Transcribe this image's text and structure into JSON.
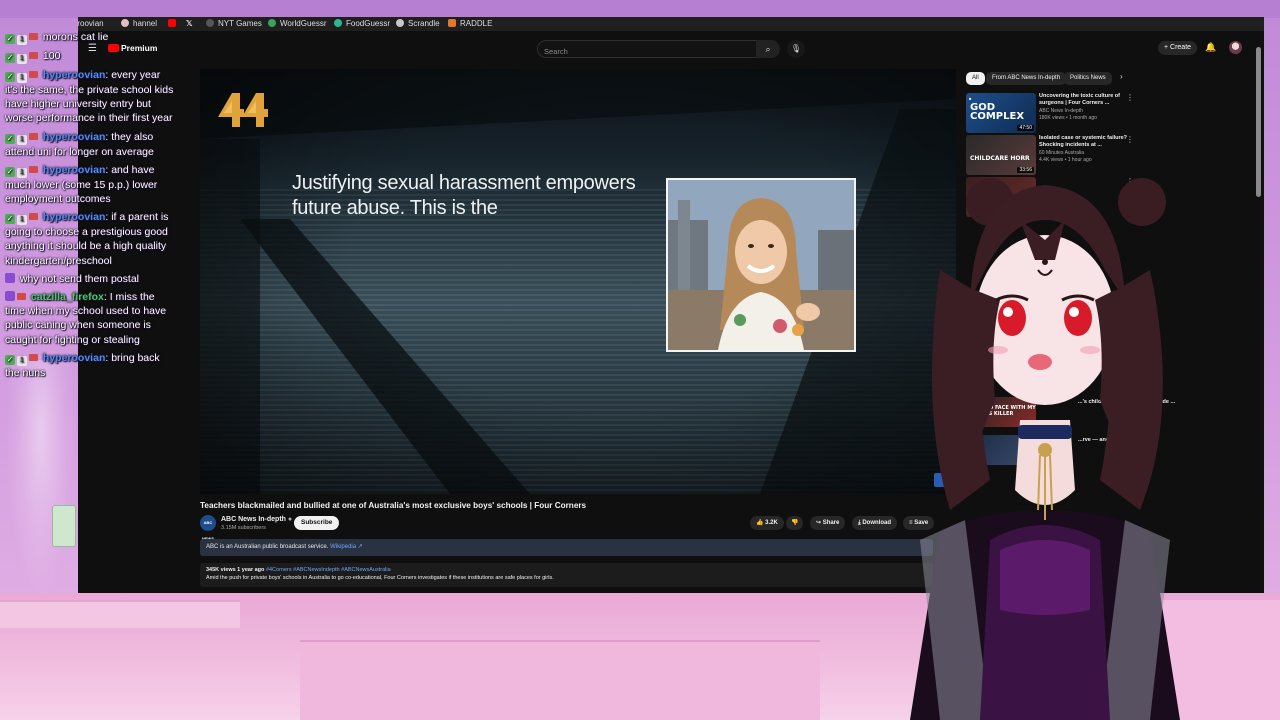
{
  "chat": {
    "lines": [
      {
        "user": "",
        "text": "morons cat lie",
        "badges": [
          "green",
          "mod",
          "sub"
        ]
      },
      {
        "user": "",
        "text": "100",
        "badges": [
          "green",
          "mod",
          "sub"
        ]
      },
      {
        "user": "hyperoovian",
        "text": "every year it's the same, the private school kids have higher university entry but worse performance in their first year",
        "badges": [
          "green",
          "mod",
          "sub"
        ]
      },
      {
        "user": "hyperoovian",
        "text": "they also attend uni for longer on average",
        "badges": [
          "green",
          "mod",
          "sub"
        ]
      },
      {
        "user": "hyperoovian",
        "text": "and have much lower (some 15 p.p.) lower employment outcomes",
        "badges": [
          "green",
          "mod",
          "sub"
        ]
      },
      {
        "user": "hyperoovian",
        "text": "if a parent is going to choose a prestigious good anything it should be a high quality kindergarten/preschool",
        "badges": [
          "green",
          "mod",
          "sub"
        ]
      },
      {
        "user": "",
        "text": "why not send them postal",
        "badges": [
          "purple"
        ]
      },
      {
        "user": "catzilla_firefox",
        "text": "I miss the time when my school used to have public caning when someone is caught for fighting or stealing",
        "badges": [
          "purple",
          "sub"
        ]
      },
      {
        "user": "hyperoovian",
        "text": "bring back the nuns",
        "badges": [
          "green",
          "mod",
          "sub"
        ]
      }
    ]
  },
  "bookmarks": [
    {
      "label": "hyperoovian",
      "icon": "avatar-icon",
      "color": "#c89090"
    },
    {
      "label": "hannel",
      "icon": "avatar-icon",
      "color": "#e0c0c0"
    },
    {
      "label": "",
      "icon": "youtube-icon",
      "color": "#ff0000"
    },
    {
      "label": "",
      "icon": "x-icon",
      "color": "#ffffff"
    },
    {
      "label": "NYT Games",
      "icon": "nyt-icon",
      "color": "#555555"
    },
    {
      "label": "WorldGuessr",
      "icon": "globe-icon",
      "color": "#3aa35c"
    },
    {
      "label": "FoodGuessr",
      "icon": "food-icon",
      "color": "#2db88e"
    },
    {
      "label": "Scrandle",
      "icon": "scrandle-icon",
      "color": "#c8c8c8"
    },
    {
      "label": "RADDLE",
      "icon": "raddle-icon",
      "color": "#e07a2a"
    }
  ],
  "header": {
    "logo": "Premium",
    "search_placeholder": "Search",
    "create_label": "+ Create"
  },
  "video": {
    "caption": "Justifying sexual harassment empowers future abuse. This is the",
    "title": "Teachers blackmailed and bullied at one of Australia's most exclusive boys' schools | Four Corners",
    "channel": "ABC News In-depth",
    "subscribers": "3.15M subscribers",
    "subscribe_label": "Subscribe",
    "channel_avatar_text": "ABC NEWS",
    "likes": "3.2K",
    "share_label": "Share",
    "download_label": "Download",
    "save_label": "Save",
    "info_text": "ABC is an Australian public broadcast service.",
    "info_link": "Wikipedia",
    "views_date": "345K views  1 year ago",
    "tags": "#4Corners #ABCNewsIndepth #ABCNewsAustralia",
    "description": "Amid the push for private boys' schools in Australia to go co-educational, Four Corners investigates if these institutions are safe places for girls."
  },
  "chips": [
    {
      "label": "All",
      "active": true
    },
    {
      "label": "From ABC News In-depth",
      "active": false
    },
    {
      "label": "Politics News",
      "active": false
    }
  ],
  "recommendations": [
    {
      "title": "Uncovering the toxic culture of surgeons | Four Corners ...",
      "channel": "ABC News In-depth",
      "meta": "180K views • 1 month ago",
      "thumb_text": "GOD COMPLEX",
      "duration": "47:50"
    },
    {
      "title": "Isolated case or systemic failure? Shocking incidents at ...",
      "channel": "60 Minutes Australia",
      "meta": "4.4K views • 1 hour ago",
      "thumb_text": "CHILDCARE HORR",
      "duration": "33:56"
    }
  ],
  "partial_recs": [
    {
      "title": "...'s children's killer moment inside ...",
      "thumb_text": "FACE TO FACE WITH MY CHILD'S KILLER"
    },
    {
      "title": "...rve — and ...",
      "thumb_text": ""
    }
  ],
  "colors": {
    "accent_red": "#ff0000",
    "link_blue": "#6ea8ff",
    "chat_user_blue": "#4b8ff2",
    "chat_user_green": "#3fcf5f"
  }
}
